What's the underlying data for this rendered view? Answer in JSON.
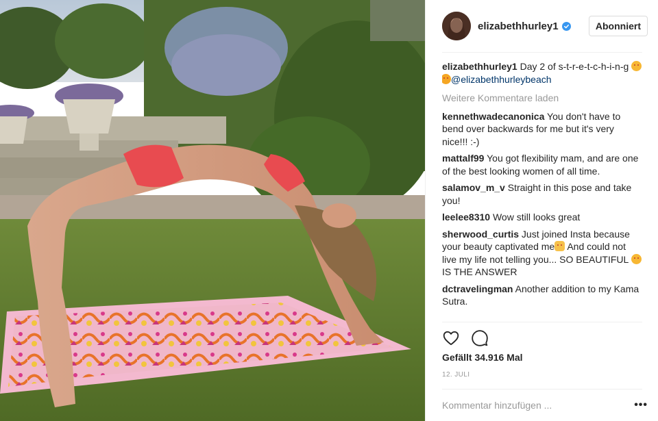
{
  "post": {
    "username": "elizabethhurley1",
    "follow_label": "Abonniert",
    "caption": {
      "user": "elizabethhurley1",
      "text": "Day 2 of s-t-r-e-t-c-h-i-n-g",
      "mention": "@elizabethhurleybeach"
    },
    "load_more": "Weitere Kommentare laden",
    "comments": [
      {
        "user": "kennethwadecanonica",
        "text": "You don't have to bend over backwards for me but it's very nice!!! :-)"
      },
      {
        "user": "mattalf99",
        "text": "You got flexibility mam, and are one of the best looking women of all time."
      },
      {
        "user": "salamov_m_v",
        "text": "Straight in this pose and take you!"
      },
      {
        "user": "leelee8310",
        "text": "Wow still looks great"
      },
      {
        "user": "sherwood_curtis",
        "text_a": "Just joined Insta because your beauty captivated me",
        "text_b": "And could not live my life not telling you... SO BEAUTIFUL",
        "text_c": "IS THE ANSWER"
      },
      {
        "user": "dctravelingman",
        "text": "Another addition to my Kama Sutra."
      }
    ],
    "likes": "Gefällt 34.916 Mal",
    "date": "12. JULI",
    "comment_placeholder": "Kommentar hinzufügen ...",
    "more_label": "•••"
  },
  "icons": {
    "like": "heart-icon",
    "comment": "comment-icon",
    "verified": "verified-badge-icon",
    "more": "more-options-icon"
  },
  "colors": {
    "mention": "#003569",
    "verified": "#3897f0",
    "muted": "#999999"
  }
}
